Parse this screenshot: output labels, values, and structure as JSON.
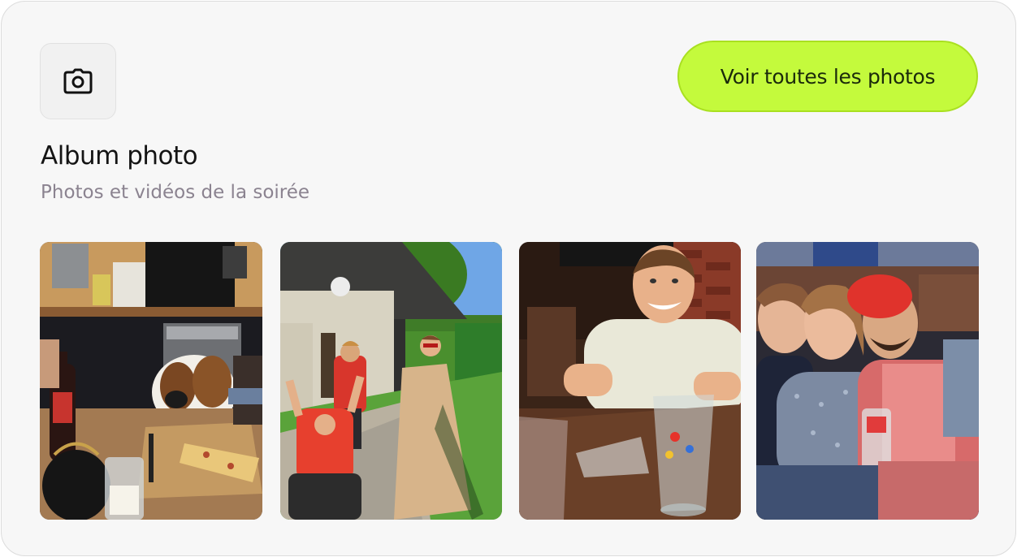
{
  "album": {
    "icon": "camera-icon",
    "title": "Album photo",
    "subtitle": "Photos et vidéos de la soirée",
    "cta_label": "Voir toutes les photos"
  },
  "colors": {
    "card_background": "#f7f7f7",
    "accent": "#c4fa3c",
    "subtitle_text": "#8b8390"
  },
  "photos": [
    {
      "subject": "kitchen-dog-pizza-photo"
    },
    {
      "subject": "garden-friends-photo"
    },
    {
      "subject": "smiling-man-table-photo"
    },
    {
      "subject": "three-friends-selfie-photo"
    }
  ]
}
